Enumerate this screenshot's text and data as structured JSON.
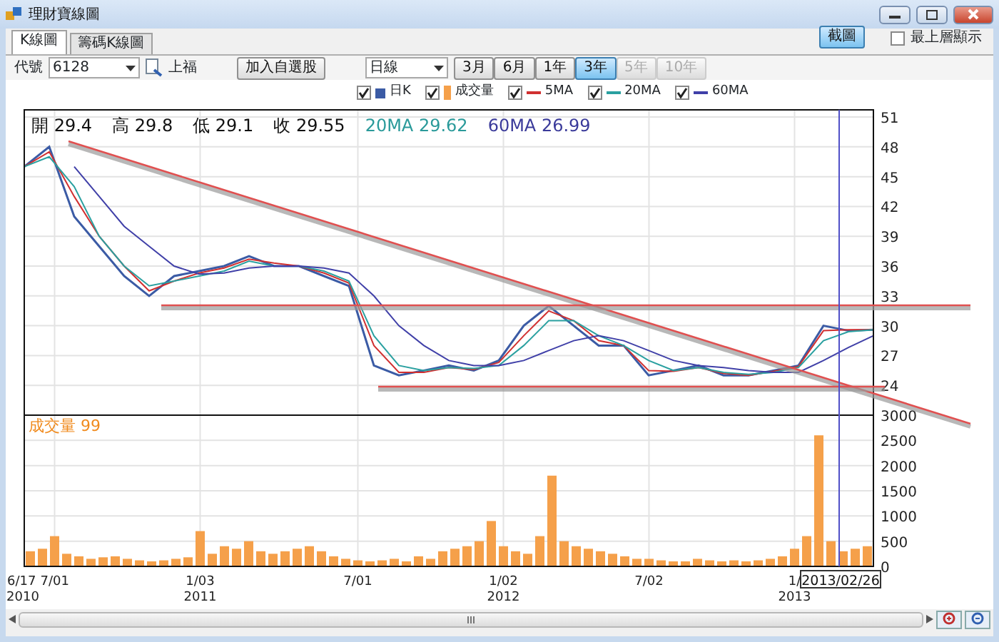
{
  "window": {
    "title": "理財寶線圖"
  },
  "tabs": [
    {
      "label": "K線圖",
      "selected": true
    },
    {
      "label": "籌碼K線圖",
      "selected": false
    }
  ],
  "screenshot_button": "截圖",
  "always_on_top": {
    "label": "最上層顯示",
    "checked": false
  },
  "toolbar": {
    "code_label": "代號",
    "code_value": "6128",
    "stock_name": "上福",
    "add_button": "加入自選股",
    "period_value": "日線",
    "ranges": [
      {
        "label": "3月",
        "selected": false,
        "disabled": false
      },
      {
        "label": "6月",
        "selected": false,
        "disabled": false
      },
      {
        "label": "1年",
        "selected": false,
        "disabled": false
      },
      {
        "label": "3年",
        "selected": true,
        "disabled": false
      },
      {
        "label": "5年",
        "selected": false,
        "disabled": true
      },
      {
        "label": "10年",
        "selected": false,
        "disabled": true
      }
    ]
  },
  "legend": [
    {
      "checked": true,
      "kind": "square"
    },
    {
      "checked": true,
      "kind": "bar"
    },
    {
      "checked": true,
      "kind": "line"
    },
    {
      "checked": true,
      "kind": "line"
    },
    {
      "checked": true,
      "kind": "line"
    }
  ],
  "quote": [
    {
      "text": "開 29.4",
      "kind": "ohlc"
    },
    {
      "text": "高 29.8",
      "kind": "ohlc"
    },
    {
      "text": "低 29.1",
      "kind": "ohlc"
    },
    {
      "text": "收 29.55",
      "kind": "ohlc"
    },
    {
      "text": "20MA 29.62",
      "kind": "ma20"
    },
    {
      "text": "60MA 26.99",
      "kind": "ma60"
    }
  ],
  "price_chart": {
    "chart_data": {
      "type": "line",
      "categories": [
        null,
        null,
        null,
        null,
        null,
        null,
        null,
        null,
        null,
        null,
        null,
        null,
        null,
        null,
        null,
        null,
        null,
        null,
        null,
        null,
        null,
        null,
        null,
        null,
        null,
        null,
        null,
        null,
        null,
        null,
        null,
        null,
        null,
        null,
        null
      ],
      "series": [
        {
          "name": "日K",
          "color": "#3b5ba5",
          "values": [
            46,
            48,
            41,
            38,
            35,
            33,
            35,
            35.5,
            36,
            37,
            36,
            36,
            35,
            34,
            26,
            25,
            25.5,
            26,
            25.5,
            26.5,
            30,
            32,
            30,
            28,
            28,
            25,
            25.5,
            26,
            25,
            25,
            25.5,
            26,
            30,
            29.5,
            29.6
          ]
        },
        {
          "name": "5MA",
          "color": "#d03030",
          "values": [
            46,
            47.5,
            43,
            39,
            36,
            33.5,
            34.5,
            35.3,
            35.8,
            36.7,
            36.3,
            36,
            35.3,
            34.3,
            28,
            25.3,
            25.3,
            25.8,
            25.6,
            26.3,
            29,
            31.5,
            30.5,
            28.5,
            28,
            25.5,
            25.4,
            25.8,
            25.2,
            25,
            25.4,
            25.9,
            29.5,
            29.6,
            29.6
          ]
        },
        {
          "name": "20MA",
          "color": "#2aa0a0",
          "values": [
            46,
            47,
            44,
            39,
            36,
            34,
            34.5,
            35,
            35.5,
            36.5,
            36,
            36,
            35.5,
            34.5,
            29,
            26,
            25.5,
            25.8,
            25.7,
            26,
            28,
            30.5,
            30.5,
            29,
            28,
            26.5,
            25.5,
            25.8,
            25.3,
            25.1,
            25.3,
            25.8,
            28.5,
            29.4,
            29.6
          ]
        },
        {
          "name": "60MA",
          "color": "#4040a8",
          "values": [
            null,
            null,
            46,
            43,
            40,
            38,
            36,
            35.2,
            35.3,
            35.8,
            36,
            36,
            35.8,
            35.3,
            33,
            30,
            28,
            26.5,
            26,
            26,
            26.5,
            27.5,
            28.5,
            29,
            28.5,
            27.5,
            26.5,
            26,
            25.8,
            25.5,
            25.3,
            25.3,
            26.5,
            27.8,
            29
          ]
        }
      ],
      "ylim": [
        21,
        51.72
      ],
      "yticks": [
        24,
        27,
        30,
        33,
        36,
        39,
        42,
        45,
        48,
        51
      ]
    },
    "cursor_label": "2013/02/26"
  },
  "volume_chart": {
    "title": "成交量 99",
    "chart_data": {
      "type": "bar",
      "categories": [
        "6/17",
        null,
        "7/01",
        null,
        null,
        null,
        null,
        null,
        null,
        null,
        null,
        null,
        null,
        null,
        "1/03",
        null,
        null,
        null,
        null,
        null,
        null,
        null,
        null,
        null,
        null,
        null,
        null,
        "7/01",
        null,
        null,
        null,
        null,
        null,
        null,
        null,
        null,
        null,
        null,
        null,
        "1/02",
        null,
        null,
        null,
        null,
        null,
        null,
        null,
        null,
        null,
        null,
        null,
        "7/02",
        null,
        null,
        null,
        null,
        null,
        null,
        null,
        null,
        null,
        null,
        null,
        "1/",
        null,
        null,
        null,
        null,
        null,
        null
      ],
      "series": [
        {
          "name": "成交量",
          "color": "#f5a04a",
          "values": [
            300,
            350,
            600,
            250,
            200,
            150,
            180,
            200,
            150,
            120,
            100,
            120,
            150,
            180,
            700,
            250,
            400,
            350,
            500,
            300,
            250,
            300,
            350,
            400,
            300,
            200,
            150,
            120,
            100,
            120,
            150,
            100,
            200,
            150,
            300,
            350,
            400,
            500,
            900,
            400,
            300,
            250,
            600,
            1800,
            500,
            400,
            350,
            300,
            250,
            200,
            150,
            150,
            120,
            100,
            100,
            150,
            120,
            100,
            120,
            100,
            120,
            150,
            200,
            350,
            600,
            2600,
            500,
            300,
            350,
            400
          ]
        }
      ],
      "ylim": [
        0,
        3000
      ],
      "yticks": [
        0,
        500,
        1000,
        1500,
        2000,
        2500,
        3000
      ]
    }
  },
  "year_labels": [
    "2010",
    "2011",
    "2012",
    "2013"
  ]
}
